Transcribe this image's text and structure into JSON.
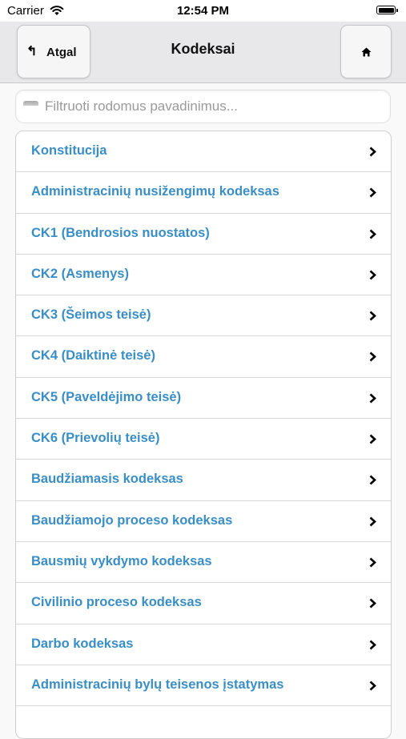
{
  "status_bar": {
    "carrier": "Carrier",
    "time": "12:54 PM"
  },
  "header": {
    "back_label": "Atgal",
    "title": "Kodeksai"
  },
  "search": {
    "placeholder": "Filtruoti rodomus pavadinimus..."
  },
  "list": {
    "items": [
      "Konstitucija",
      "Administracinių nusižengimų kodeksas",
      "CK1 (Bendrosios nuostatos)",
      "CK2 (Asmenys)",
      "CK3 (Šeimos teisė)",
      "CK4 (Daiktinė teisė)",
      "CK5 (Paveldėjimo teisė)",
      "CK6 (Prievolių teisė)",
      "Baudžiamasis kodeksas",
      "Baudžiamojo proceso kodeksas",
      "Bausmių vykdymo kodeksas",
      "Civilinio proceso kodeksas",
      "Darbo kodeksas",
      "Administracinių bylų teisenos įstatymas",
      ""
    ]
  },
  "colors": {
    "link": "#3a8ec6",
    "header_bg": "#e8e8ea"
  }
}
